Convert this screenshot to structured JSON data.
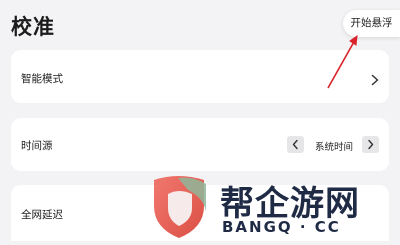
{
  "header": {
    "title": "校准",
    "float_button_label": "开始悬浮"
  },
  "cards": {
    "smart_mode": {
      "label": "智能模式"
    },
    "time_source": {
      "label": "时间源",
      "value": "系统时间"
    },
    "network_delay": {
      "label": "全网延迟"
    }
  },
  "watermark": {
    "text_cn": "帮企游网",
    "text_en": "BANGQ · CC"
  },
  "colors": {
    "annotation_arrow": "#d9222a",
    "watermark_red": "#e8453c",
    "watermark_dark": "#1f2a44"
  },
  "icons": {
    "chevron": "chevron-right-icon",
    "prev": "chevron-left-icon",
    "next": "chevron-right-icon",
    "logo": "shield-logo"
  }
}
